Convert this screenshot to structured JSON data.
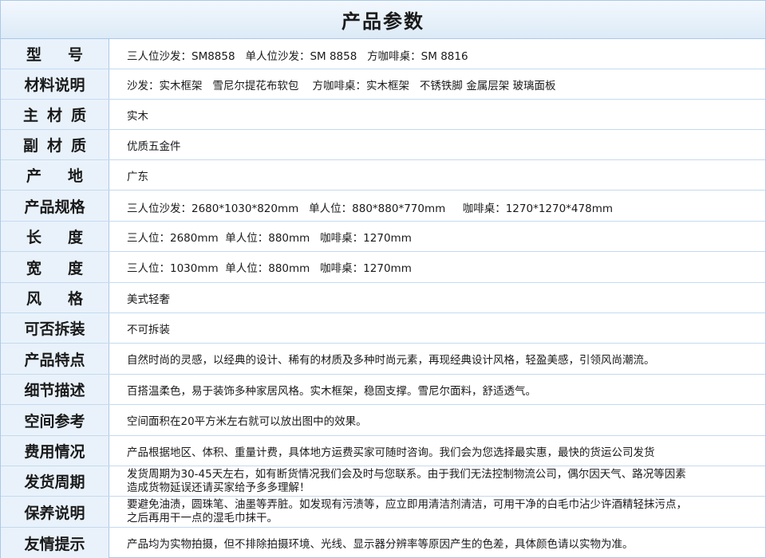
{
  "title": "产品参数",
  "rows": [
    {
      "label": [
        "型",
        "号"
      ],
      "value": "三人位沙发：SM8858   单人位沙发：SM 8858   方咖啡桌：SM 8816"
    },
    {
      "label": [
        "材料说明"
      ],
      "value": "沙发：实木框架   雪尼尔提花布软包    方咖啡桌：实木框架   不锈铁脚 金属层架 玻璃面板"
    },
    {
      "label": [
        "主",
        "材",
        "质"
      ],
      "value": "实木"
    },
    {
      "label": [
        "副",
        "材",
        "质"
      ],
      "value": "优质五金件"
    },
    {
      "label": [
        "产",
        "地"
      ],
      "value": "广东"
    },
    {
      "label": [
        "产品规格"
      ],
      "value": "三人位沙发：2680*1030*820mm   单人位：880*880*770mm     咖啡桌：1270*1270*478mm"
    },
    {
      "label": [
        "长",
        "度"
      ],
      "value": "三人位：2680mm  单人位：880mm   咖啡桌：1270mm"
    },
    {
      "label": [
        "宽",
        "度"
      ],
      "value": "三人位：1030mm  单人位：880mm   咖啡桌：1270mm"
    },
    {
      "label": [
        "风",
        "格"
      ],
      "value": "美式轻奢"
    },
    {
      "label": [
        "可否拆装"
      ],
      "value": "不可拆装"
    },
    {
      "label": [
        "产品特点"
      ],
      "value": "自然时尚的灵感，以经典的设计、稀有的材质及多种时尚元素，再现经典设计风格，轻盈美感，引领风尚潮流。"
    },
    {
      "label": [
        "细节描述"
      ],
      "value": "百搭温柔色，易于装饰多种家居风格。实木框架，稳固支撑。雪尼尔面料，舒适透气。"
    },
    {
      "label": [
        "空间参考"
      ],
      "value": "空间面积在20平方米左右就可以放出图中的效果。"
    },
    {
      "label": [
        "费用情况"
      ],
      "value": "产品根据地区、体积、重量计费，具体地方运费买家可随时咨询。我们会为您选择最实惠，最快的货运公司发货"
    },
    {
      "label": [
        "发货周期"
      ],
      "value_lines": [
        "发货周期为30-45天左右，如有断货情况我们会及时与您联系。由于我们无法控制物流公司，偶尔因天气、路况等因素",
        "造成货物延误还请买家给予多多理解！"
      ]
    },
    {
      "label": [
        "保养说明"
      ],
      "value_lines": [
        "要避免油渍，圆珠笔、油墨等弄脏。如发现有污渍等，应立即用清洁剂清洁，可用干净的白毛巾沾少许酒精轻抹污点，",
        "之后再用干一点的湿毛巾抹干。"
      ]
    },
    {
      "label": [
        "友情提示"
      ],
      "value": "产品均为实物拍摄，但不排除拍摄环境、光线、显示器分辨率等原因产生的色差，具体颜色请以实物为准。"
    }
  ]
}
